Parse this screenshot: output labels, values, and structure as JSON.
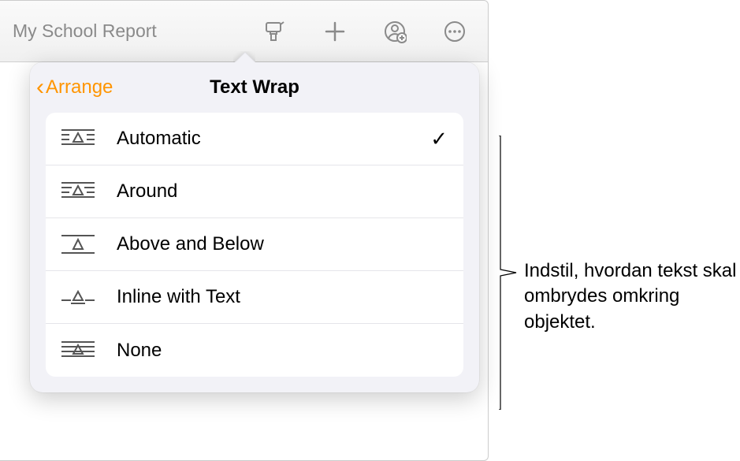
{
  "toolbar": {
    "doc_title": "My School Report"
  },
  "popover": {
    "back_label": "Arrange",
    "title": "Text Wrap",
    "options": [
      {
        "label": "Automatic",
        "selected": true,
        "icon": "wrap-automatic"
      },
      {
        "label": "Around",
        "selected": false,
        "icon": "wrap-around"
      },
      {
        "label": "Above and Below",
        "selected": false,
        "icon": "wrap-above-below"
      },
      {
        "label": "Inline with Text",
        "selected": false,
        "icon": "wrap-inline"
      },
      {
        "label": "None",
        "selected": false,
        "icon": "wrap-none"
      }
    ]
  },
  "callout": {
    "text": "Indstil, hvordan tekst skal ombrydes omkring objektet."
  }
}
